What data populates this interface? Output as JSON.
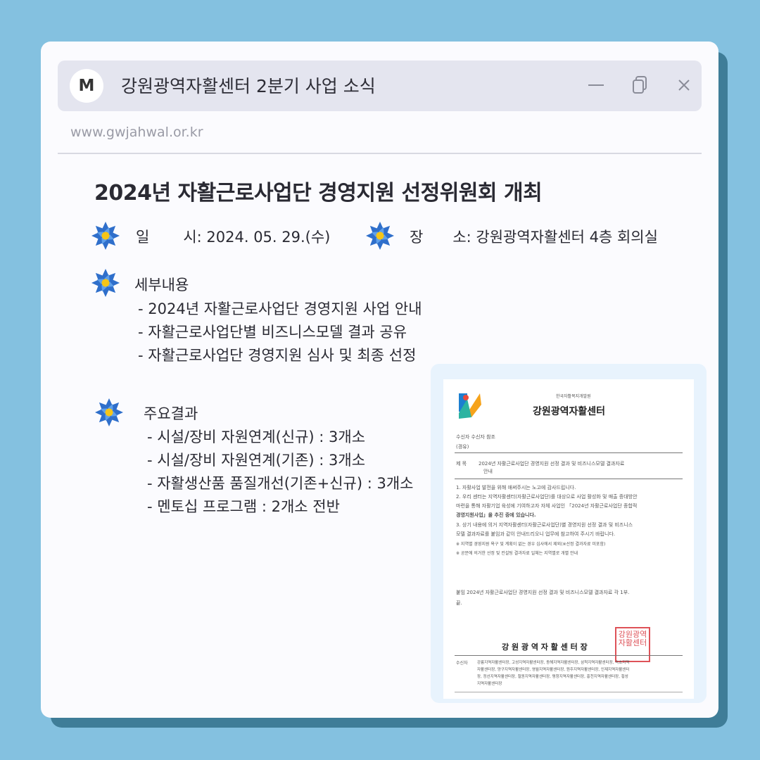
{
  "window": {
    "avatar_letter": "M",
    "title": "강원광역자활센터 2분기 사업 소식",
    "url": "www.gwjahwal.or.kr"
  },
  "post": {
    "heading": "2024년 자활근로사업단 경영지원 선정위원회 개최",
    "date_label_a": "일",
    "date_label_b": "시: 2024. 05. 29.(수)",
    "place_label_a": "장",
    "place_label_b": "소: 강원광역자활센터 4층 회의실",
    "details_title": "세부내용",
    "details": [
      "- 2024년 자활근로사업단 경영지원 사업 안내",
      "- 자활근로사업단별 비즈니스모델 결과 공유",
      "- 자활근로사업단 경영지원 심사 및 최종 선정"
    ],
    "results_title": "주요결과",
    "results": [
      "- 시설/장비 자원연계(신규) : 3개소",
      "- 시설/장비 자원연계(기존) : 3개소",
      "- 자활생산품 품질개선(기존+신규) : 3개소",
      "- 멘토십 프로그램 : 2개소 전반"
    ]
  },
  "document": {
    "org_small": "한국자활복지개발원",
    "org_name": "강원광역자활센터",
    "recipient": "수신자   수신자 참조",
    "via": "(경유)",
    "subject_label": "제  목",
    "subject_1": "2024년 자활근로사업단 경영지원 선정 결과 및 비즈니스모델 결과자료",
    "subject_2": "안내",
    "body": [
      "1. 자활사업 발전을 위해 애써주시는 노고에 감사드립니다.",
      "2. 우리 센터는 지역자활센터(자활근로사업단)를 대상으로 사업 활성화 및 매출 증대방안",
      "    마련을 통해 자활기업 육성에 기여하고자 자체 사업인 「2024년 자활근로사업단 종합적",
      "    경영지원사업」을 추진 중에 있습니다.",
      "3. 상기 내용에 의거 지역자활센터(자활근로사업단)별 경영지원 선정 결과 및 비즈니스",
      "    모델 결과자료를 붙임과 같이 안내드리오니 업무에 참고하여 주시기 바랍니다.",
      "    ※ 지역별 경영지원 욕구 및 계획이 없는 경우 심사에서 제외(※선정 결과자료 미포함)",
      "    ※ 공문에 의거한 선정 및 컨설팅 결과자료 일체는 지역별로 개별 안내"
    ],
    "attachment": "붙임   2024년 자활근로사업단 경영지원 선정 결과 및 비즈니스모델 결과자료 각 1부.",
    "end": "끝.",
    "signer": "강 원 광 역 자 활 센 터 장",
    "seal_text": "강원광역자활센터",
    "cc_label": "수신자",
    "cc": [
      "강릉지역자활센터장, 고성지역자활센터장, 동해지역자활센터장, 삼척지역자활센터장, 속초지역",
      "자활센터장, 양구지역자활센터장, 영월지역자활센터장, 원주지역자활센터장, 인제지역자활센터",
      "장, 정선지역자활센터장, 철원지역자활센터장, 평창지역자활센터장, 홍천지역자활센터장, 횡성",
      "지역자활센터장"
    ]
  },
  "colors": {
    "background": "#84c1e0",
    "card_shadow": "#3f7d98",
    "flower_outer": "#2f6fcb",
    "flower_inner": "#5fa0ea",
    "flower_center": "#f5c518"
  }
}
